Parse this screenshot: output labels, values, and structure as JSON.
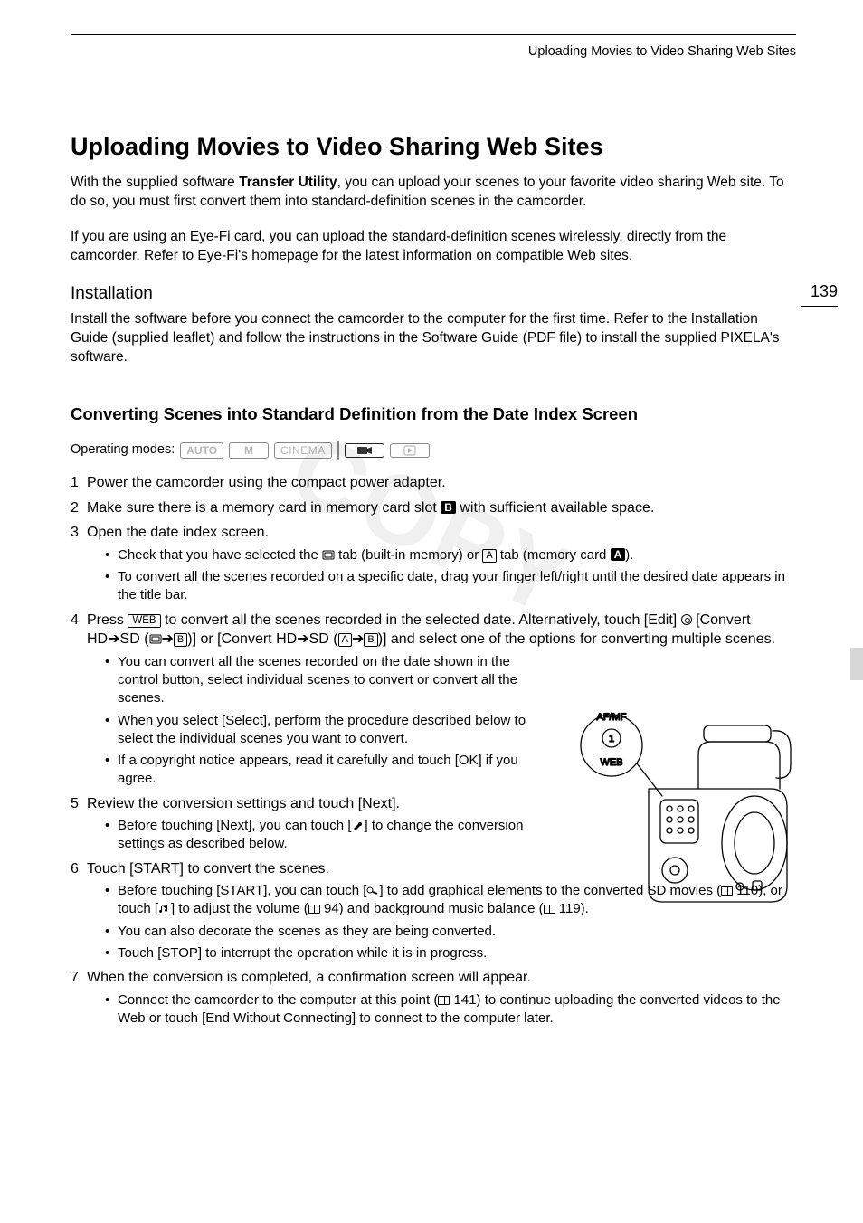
{
  "running_header": "Uploading Movies to Video Sharing Web Sites",
  "page_number": "139",
  "watermark": "COPY",
  "title": "Uploading Movies to Video Sharing Web Sites",
  "intro": {
    "p1_a": "With the supplied software ",
    "p1_bold": "Transfer Utility",
    "p1_b": ", you can upload your scenes to your favorite video sharing Web site. To do so, you must first convert them into standard-definition scenes in the camcorder.",
    "p2": "If you are using an Eye-Fi card, you can upload the standard-definition scenes wirelessly, directly from the camcorder. Refer to Eye-Fi's homepage for the latest information on compatible Web sites."
  },
  "installation": {
    "heading": "Installation",
    "body": "Install the software before you connect the camcorder to the computer for the first time. Refer to the Installation Guide (supplied leaflet) and follow the instructions in the Software Guide (PDF file) to install the supplied PIXELA's software."
  },
  "converting": {
    "heading": "Converting Scenes into Standard Definition from the Date Index Screen",
    "modes_label": "Operating modes:",
    "modes": {
      "auto": "AUTO",
      "m": "M",
      "cinema": "CINEMA"
    }
  },
  "steps": {
    "s1": "Power the camcorder using the compact power adapter.",
    "s2_a": "Make sure there is a memory card in memory card slot ",
    "s2_badge": "B",
    "s2_b": " with sufficient available space.",
    "s3": "Open the date index screen.",
    "s3_bullets": {
      "b1_a": "Check that you have selected the ",
      "b1_b": " tab (built-in memory) or ",
      "b1_badge_a": "A",
      "b1_c": " tab (memory card ",
      "b1_badge_adark": "A",
      "b1_d": ").",
      "b2": "To convert all the scenes recorded on a specific date, drag your finger left/right until the desired date appears in the title bar."
    },
    "s4_a": "Press ",
    "s4_web": "WEB",
    "s4_b": " to convert all the scenes recorded in the selected date. Alternatively, touch [Edit] ",
    "s4_c": " [Convert HD",
    "s4_arrow": "➔",
    "s4_sd": "SD (",
    "s4_d": " ",
    "s4_e": ")] or [Convert HD",
    "s4_f": "SD (",
    "s4_g": ")] and select one of the options for converting multiple scenes.",
    "s4_bullets": {
      "b1": "You can convert all the scenes recorded on the date shown in the control button, select individual scenes to convert or convert all the scenes.",
      "b2": "When you select [Select], perform the procedure described below to select the individual scenes you want to convert.",
      "b3": "If a copyright notice appears, read it carefully and touch [OK] if you agree."
    },
    "s5": "Review the conversion settings and touch [Next].",
    "s5_bullets": {
      "b1_a": "Before touching [Next], you can touch [",
      "b1_b": "] to change the conversion settings as described below."
    },
    "s6": "Touch [START] to convert the scenes.",
    "s6_bullets": {
      "b1_a": "Before touching [START], you can touch [",
      "b1_b": "] to add graphical elements to the converted SD movies (",
      "b1_ref1": " 110), or touch [",
      "b1_c": "] to adjust the volume (",
      "b1_ref2": " 94) and background music balance (",
      "b1_ref3": " 119).",
      "b2": "You can also decorate the scenes as they are being converted.",
      "b3": "Touch [STOP] to interrupt the operation while it is in progress."
    },
    "s7": "When the conversion is completed, a confirmation screen will appear.",
    "s7_bullets": {
      "b1_a": "Connect the camcorder to the computer at this point (",
      "b1_ref": " 141) to continue uploading the converted videos to the Web or touch [End Without Connecting] to connect to the computer later."
    }
  },
  "figure": {
    "label_afmf": "AF/MF",
    "label_1": "1",
    "label_web": "WEB"
  }
}
